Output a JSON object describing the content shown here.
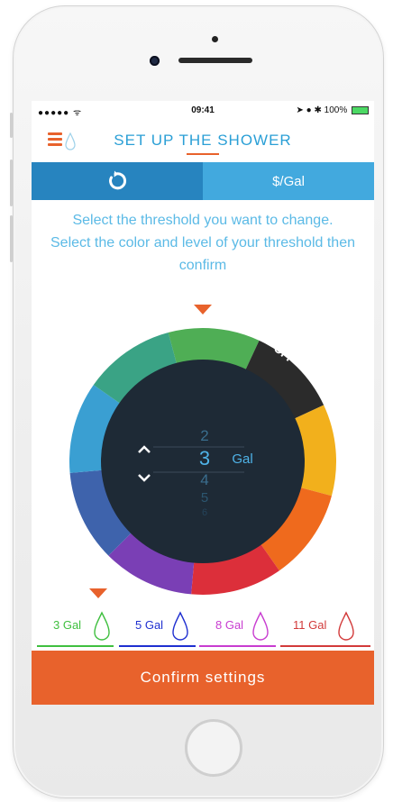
{
  "status_bar": {
    "signal": "●●●●● ᯤ",
    "time": "09:41",
    "right": "➤ ● ✱ 100%"
  },
  "header": {
    "title": "SET UP THE SHOWER"
  },
  "tabs": {
    "reset_icon": "reset-icon",
    "price_label": "$/Gal"
  },
  "instructions": {
    "line1": "Select the threshold you want to change.",
    "line2": "Select the color and level of your threshold then confirm"
  },
  "dial": {
    "off_label": "OFF",
    "picker": {
      "value_above": "2",
      "selected": "3",
      "unit": "Gal",
      "values_below": [
        "4",
        "5",
        "6"
      ]
    },
    "colors": [
      "#4fae55",
      "#2b2b2b",
      "#f2b01c",
      "#ef6a1d",
      "#dc2f3a",
      "#7a3fb5",
      "#3e63ac",
      "#3a9fd2",
      "#3aa385"
    ]
  },
  "thresholds": [
    {
      "label": "3 Gal",
      "color": "#3fbf3f",
      "selected": true
    },
    {
      "label": "5 Gal",
      "color": "#1f2fd0",
      "selected": false
    },
    {
      "label": "8 Gal",
      "color": "#c83cd0",
      "selected": false
    },
    {
      "label": "11 Gal",
      "color": "#d23a3a",
      "selected": false
    }
  ],
  "confirm_button": {
    "label": "Confirm settings"
  },
  "accent_color": "#e8622c"
}
